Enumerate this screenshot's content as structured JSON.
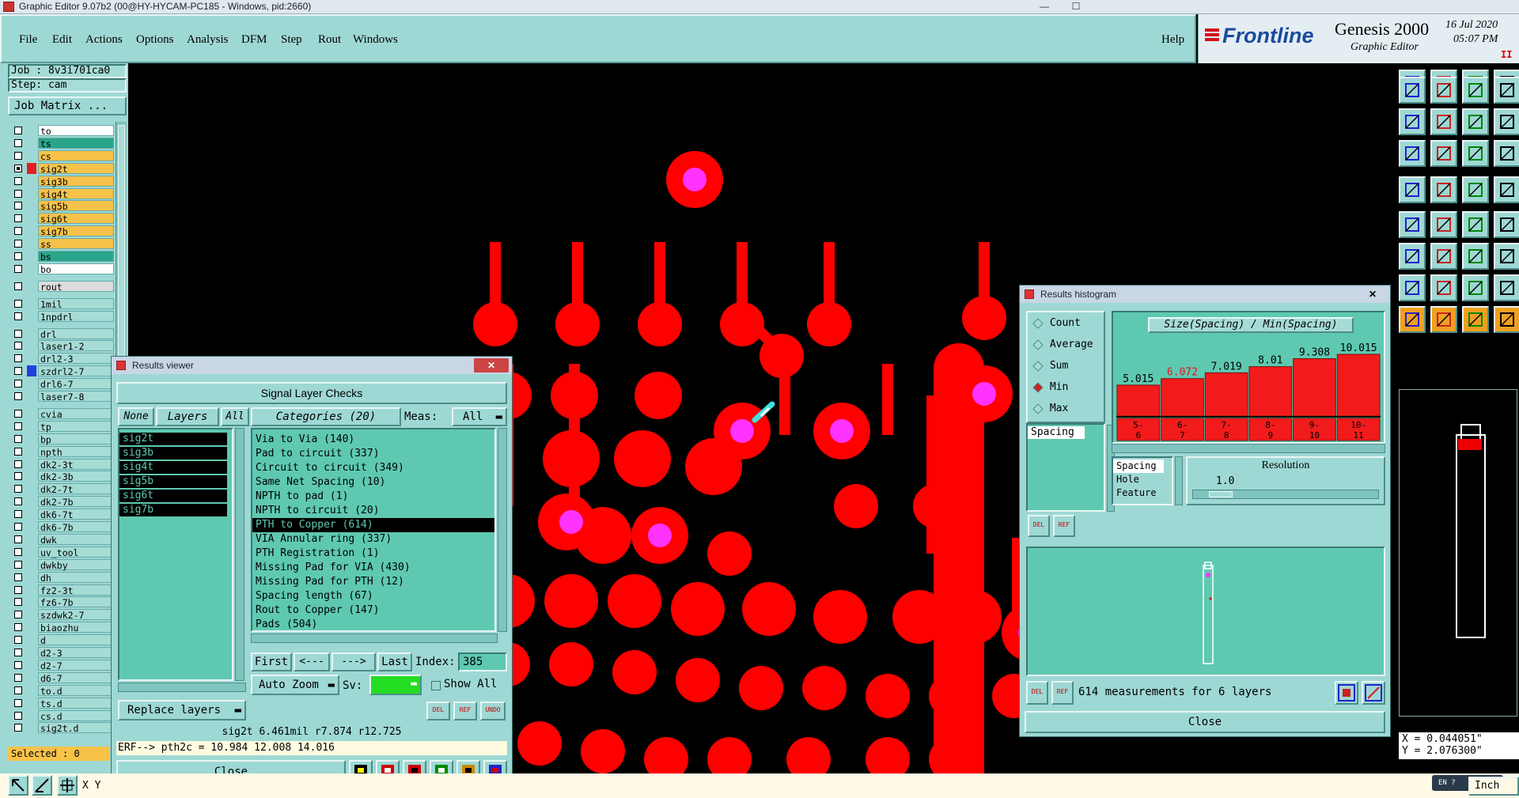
{
  "window": {
    "title": "Graphic Editor 9.07b2 (00@HY-HYCAM-PC185 - Windows, pid:2660)"
  },
  "menu": {
    "items": [
      "File",
      "Edit",
      "Actions",
      "Options",
      "Analysis",
      "DFM",
      "Step",
      "Rout",
      "Windows"
    ],
    "help": "Help"
  },
  "brand": {
    "logo": "Frontline",
    "product": "Genesis 2000",
    "subtitle": "Graphic Editor",
    "date": "16 Jul 2020",
    "time": "05:07 PM"
  },
  "job": {
    "label": "Job : 8v3i701ca0",
    "step": "Step: cam",
    "matrix": "Job Matrix ..."
  },
  "layers": [
    {
      "name": "to",
      "color": "#ffffff",
      "mark": "",
      "checked": false
    },
    {
      "name": "ts",
      "color": "#2aa58a",
      "mark": "",
      "checked": false
    },
    {
      "name": "cs",
      "color": "#f7c24a",
      "mark": "",
      "checked": false
    },
    {
      "name": "sig2t",
      "color": "#f7c24a",
      "mark": "#e02020",
      "checked": true
    },
    {
      "name": "sig3b",
      "color": "#f7c24a",
      "mark": "",
      "checked": false
    },
    {
      "name": "sig4t",
      "color": "#f7c24a",
      "mark": "",
      "checked": false
    },
    {
      "name": "sig5b",
      "color": "#f7c24a",
      "mark": "",
      "checked": false
    },
    {
      "name": "sig6t",
      "color": "#f7c24a",
      "mark": "",
      "checked": false
    },
    {
      "name": "sig7b",
      "color": "#f7c24a",
      "mark": "",
      "checked": false
    },
    {
      "name": "ss",
      "color": "#f7c24a",
      "mark": "",
      "checked": false
    },
    {
      "name": "bs",
      "color": "#2aa58a",
      "mark": "",
      "checked": false
    },
    {
      "name": "bo",
      "color": "#ffffff",
      "mark": "",
      "checked": false
    },
    {
      "name": "rout",
      "color": "#dddddd",
      "mark": "",
      "checked": false
    },
    {
      "name": "1mil",
      "color": "#a6dcd6",
      "mark": "",
      "checked": false
    },
    {
      "name": "1npdrl",
      "color": "#a6dcd6",
      "mark": "",
      "checked": false
    },
    {
      "name": "drl",
      "color": "#a6dcd6",
      "mark": "",
      "checked": false
    },
    {
      "name": "laser1-2",
      "color": "#a6dcd6",
      "mark": "",
      "checked": false
    },
    {
      "name": "drl2-3",
      "color": "#a6dcd6",
      "mark": "",
      "checked": false
    },
    {
      "name": "szdrl2-7",
      "color": "#a6dcd6",
      "mark": "#2040e0",
      "checked": false
    },
    {
      "name": "drl6-7",
      "color": "#a6dcd6",
      "mark": "",
      "checked": false
    },
    {
      "name": "laser7-8",
      "color": "#a6dcd6",
      "mark": "",
      "checked": false
    },
    {
      "name": "cvia",
      "color": "#a6dcd6",
      "mark": "",
      "checked": false
    },
    {
      "name": "tp",
      "color": "#a6dcd6",
      "mark": "",
      "checked": false
    },
    {
      "name": "bp",
      "color": "#a6dcd6",
      "mark": "",
      "checked": false
    },
    {
      "name": "npth",
      "color": "#a6dcd6",
      "mark": "",
      "checked": false
    },
    {
      "name": "dk2-3t",
      "color": "#a6dcd6",
      "mark": "",
      "checked": false
    },
    {
      "name": "dk2-3b",
      "color": "#a6dcd6",
      "mark": "",
      "checked": false
    },
    {
      "name": "dk2-7t",
      "color": "#a6dcd6",
      "mark": "",
      "checked": false
    },
    {
      "name": "dk2-7b",
      "color": "#a6dcd6",
      "mark": "",
      "checked": false
    },
    {
      "name": "dk6-7t",
      "color": "#a6dcd6",
      "mark": "",
      "checked": false
    },
    {
      "name": "dk6-7b",
      "color": "#a6dcd6",
      "mark": "",
      "checked": false
    },
    {
      "name": "dwk",
      "color": "#a6dcd6",
      "mark": "",
      "checked": false
    },
    {
      "name": "uv_tool",
      "color": "#a6dcd6",
      "mark": "",
      "checked": false
    },
    {
      "name": "dwkby",
      "color": "#a6dcd6",
      "mark": "",
      "checked": false
    },
    {
      "name": "dh",
      "color": "#a6dcd6",
      "mark": "",
      "checked": false
    },
    {
      "name": "fz2-3t",
      "color": "#a6dcd6",
      "mark": "",
      "checked": false
    },
    {
      "name": "fz6-7b",
      "color": "#a6dcd6",
      "mark": "",
      "checked": false
    },
    {
      "name": "szdwk2-7",
      "color": "#a6dcd6",
      "mark": "",
      "checked": false
    },
    {
      "name": "biaozhu",
      "color": "#a6dcd6",
      "mark": "",
      "checked": false
    },
    {
      "name": "d",
      "color": "#a6dcd6",
      "mark": "",
      "checked": false
    },
    {
      "name": "d2-3",
      "color": "#a6dcd6",
      "mark": "",
      "checked": false
    },
    {
      "name": "d2-7",
      "color": "#a6dcd6",
      "mark": "",
      "checked": false
    },
    {
      "name": "d6-7",
      "color": "#a6dcd6",
      "mark": "",
      "checked": false
    },
    {
      "name": "to.d",
      "color": "#a6dcd6",
      "mark": "",
      "checked": false
    },
    {
      "name": "ts.d",
      "color": "#a6dcd6",
      "mark": "",
      "checked": false
    },
    {
      "name": "cs.d",
      "color": "#a6dcd6",
      "mark": "",
      "checked": false
    },
    {
      "name": "sig2t.d",
      "color": "#a6dcd6",
      "mark": "",
      "checked": false
    }
  ],
  "selected": "Selected : 0",
  "results_viewer": {
    "title": "Results viewer",
    "header": "Signal Layer Checks",
    "none": "None",
    "layers": "Layers",
    "all": "All",
    "categories_label": "Categories (20)",
    "meas_label": "Meas:",
    "meas_value": "All",
    "layer_list": [
      "sig2t",
      "sig3b",
      "sig4t",
      "sig5b",
      "sig6t",
      "sig7b"
    ],
    "categories": [
      "Via to Via (140)",
      "Pad to circuit (337)",
      "Circuit to circuit (349)",
      "Same Net Spacing (10)",
      "NPTH to pad (1)",
      "NPTH to circuit (20)",
      "PTH to Copper (614)",
      "VIA Annular ring (337)",
      "PTH Registration (1)",
      "Missing Pad for VIA (430)",
      "Missing Pad for PTH (12)",
      "Spacing length (67)",
      "Rout to Copper (147)",
      "Pads (504)"
    ],
    "selected_category": 6,
    "first": "First",
    "prev": "<---",
    "next": "--->",
    "last": "Last",
    "index_label": "Index:",
    "index_value": "385",
    "auto_zoom": "Auto Zoom",
    "sv": "Sv:",
    "show_all": "Show All",
    "replace_layers": "Replace layers",
    "del": "DEL",
    "ref": "REF",
    "undo": "UNDO",
    "info": "sig2t 6.461mil  r7.874  r12.725",
    "erf": "ERF--> pth2c = 10.984 12.008 14.016",
    "close": "Close"
  },
  "histogram": {
    "title": "Results histogram",
    "modes": [
      "Count",
      "Average",
      "Sum",
      "Min",
      "Max"
    ],
    "active_mode": "Min",
    "measure_list": [
      "Spacing"
    ],
    "chart_title": "Size(Spacing) / Min(Spacing)",
    "del": "DEL",
    "ref": "REF",
    "list2": [
      "Spacing",
      "Hole",
      "Feature"
    ],
    "resolution_label": "Resolution",
    "resolution_value": "1.0",
    "summary": "614 measurements for 6 layers",
    "close": "Close"
  },
  "chart_data": {
    "type": "bar",
    "title": "Size(Spacing) / Min(Spacing)",
    "categories": [
      "5-6",
      "6-7",
      "7-8",
      "8-9",
      "9-10",
      "10-11"
    ],
    "values": [
      5.015,
      6.072,
      7.019,
      8.01,
      9.308,
      10.015
    ],
    "value_labels": [
      "5.015",
      "6.072",
      "7.019",
      "8.01",
      "9.308",
      "10.015"
    ],
    "highlight_index": 1,
    "colors": {
      "bar": "#f21b1b",
      "highlight_label": "#e0141e"
    }
  },
  "coords": {
    "x": "X = 0.044051\"",
    "y": "Y = 2.076300\"",
    "unit": "Inch"
  },
  "status": {
    "xy": "X Y"
  },
  "colors": {
    "teal": "#9ed8d4",
    "copper": "#ff0000",
    "hole": "#ff33ff"
  }
}
